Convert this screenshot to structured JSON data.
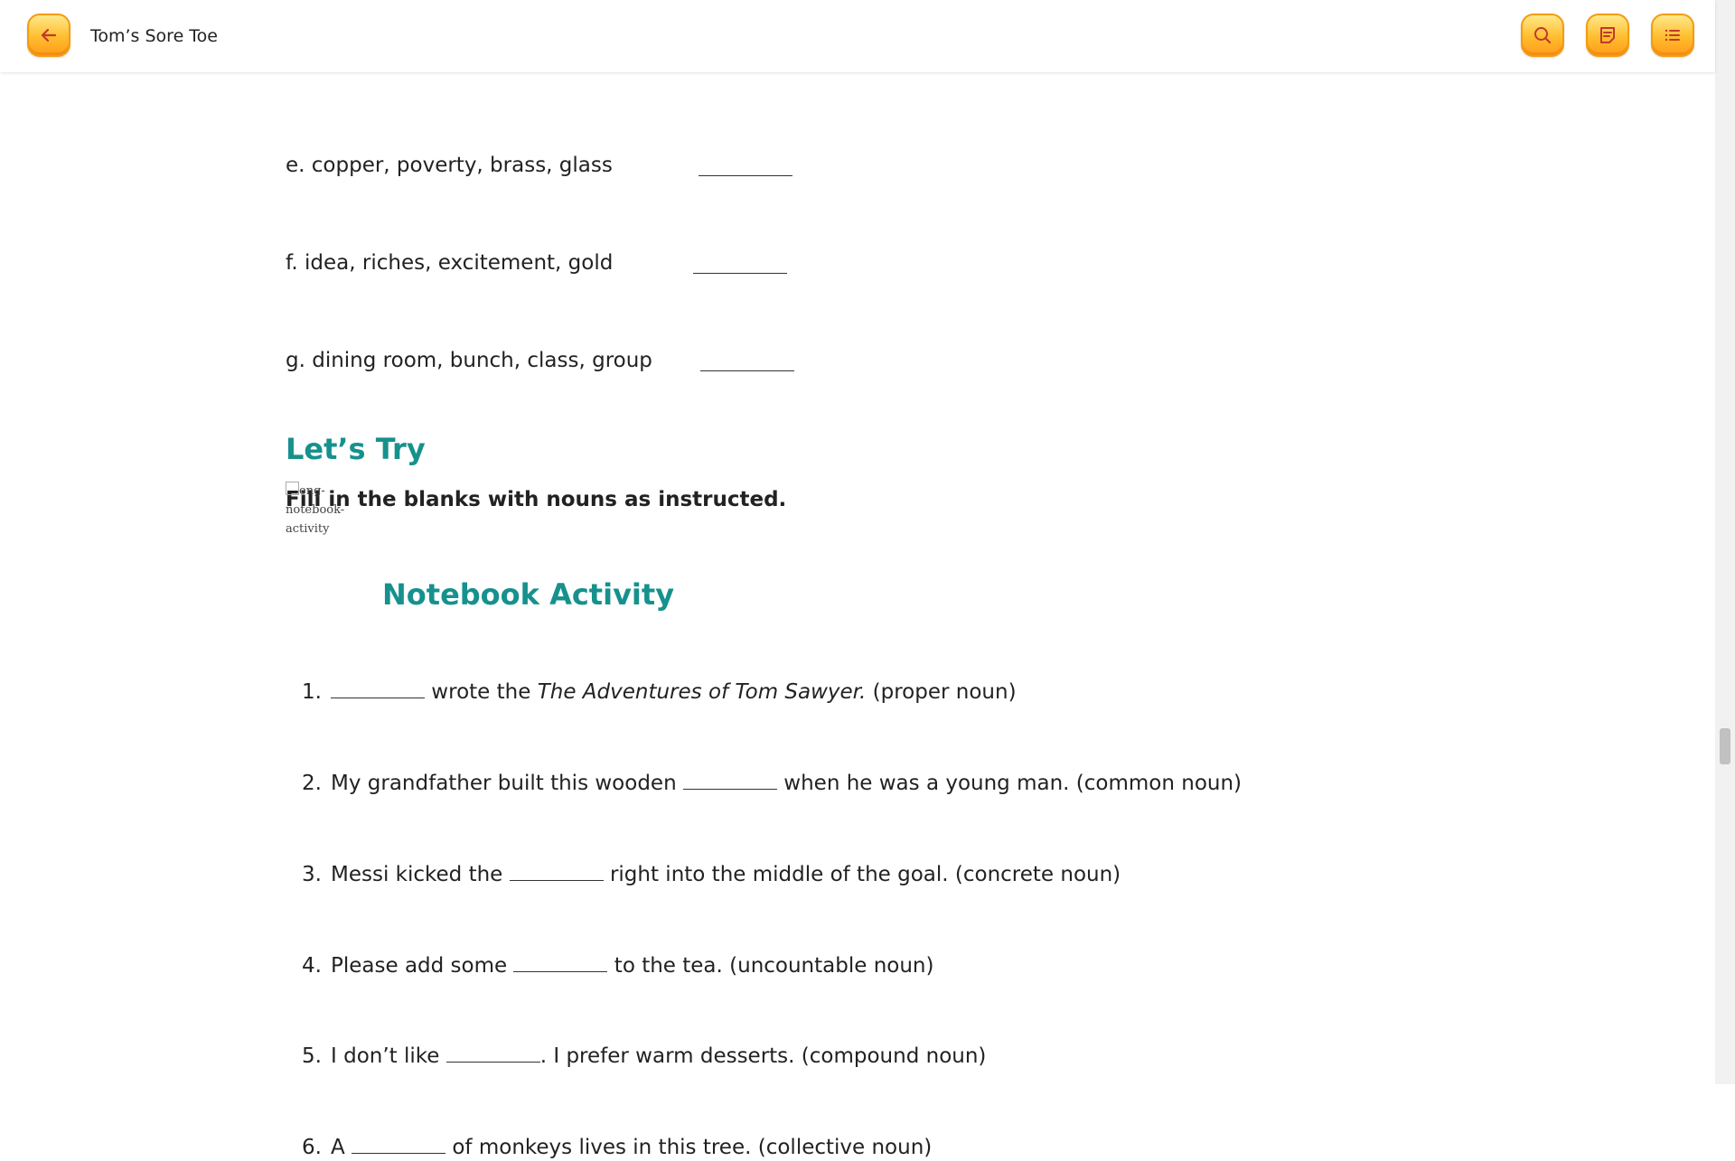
{
  "header": {
    "title": "Tom’s Sore Toe",
    "buttons": {
      "back": "back-arrow-icon",
      "search": "search-icon",
      "notes": "notes-icon",
      "toc": "list-icon"
    },
    "accent": "#ffbd2e"
  },
  "odd_items": [
    {
      "label": "e. copper, poverty, brass, glass"
    },
    {
      "label": "f. idea, riches, excitement, gold"
    },
    {
      "label": "g. dining room, bunch, class, group"
    }
  ],
  "lets_try": {
    "heading": "Let’s Try",
    "instruction": "Fill in the blanks with nouns as instructed.",
    "heading_color": "#16918d"
  },
  "notebook": {
    "img_alt": "eng-notebook-activity",
    "heading": "Notebook Activity"
  },
  "questions": [
    {
      "num": "1.",
      "before": "",
      "after": " wrote the ",
      "italic": "The Adventures of Tom Sawyer.",
      "tail": " (proper noun)"
    },
    {
      "num": "2.",
      "before": "My grandfather built this wooden ",
      "after": " when he was a young man. (common noun)"
    },
    {
      "num": "3.",
      "before": "Messi kicked the ",
      "after": " right into the middle of the goal. (concrete noun)"
    },
    {
      "num": "4.",
      "before": "Please add some ",
      "after": " to the tea. (uncountable noun)"
    },
    {
      "num": "5.",
      "before": "I don’t like ",
      "after": ". I prefer warm desserts. (compound noun)"
    },
    {
      "num": "6.",
      "before": "A ",
      "after": " of monkeys lives in this tree. (collective noun)"
    }
  ]
}
